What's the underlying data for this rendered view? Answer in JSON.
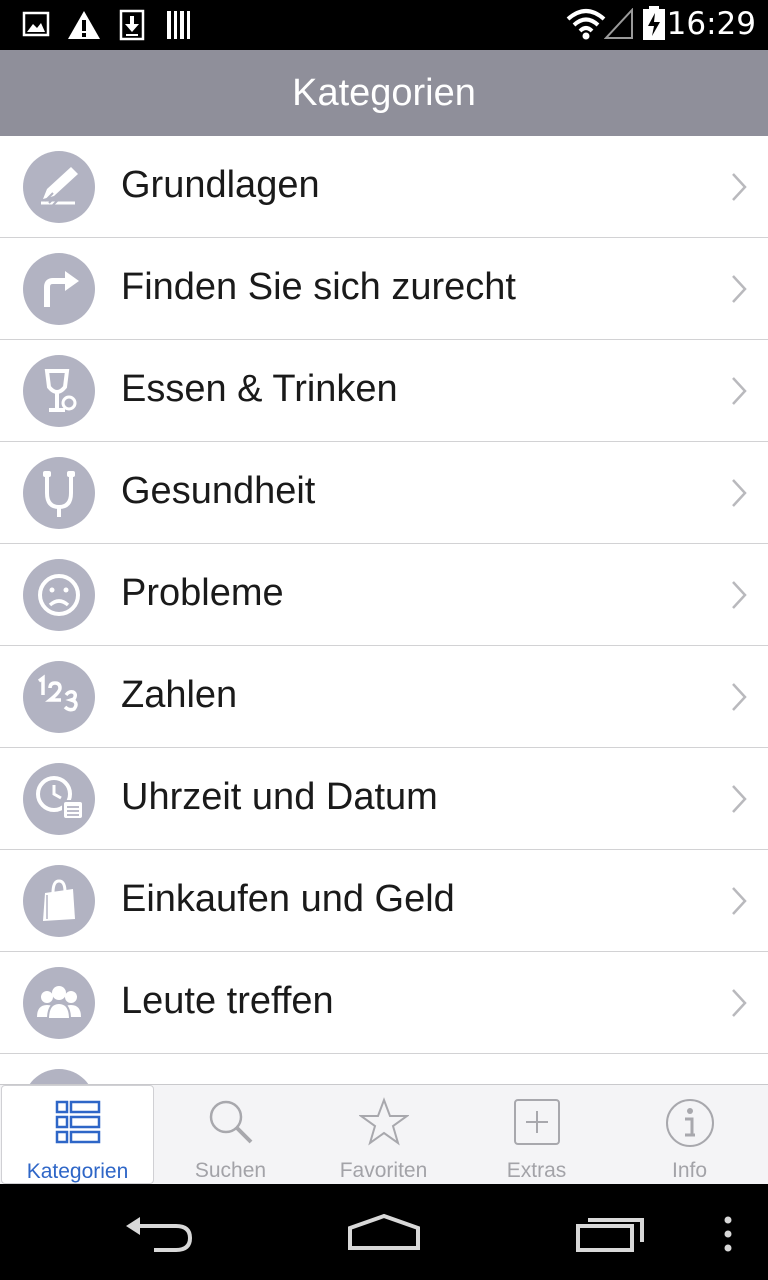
{
  "status_bar": {
    "time": "16:29",
    "left_icons": [
      "image-icon",
      "warning-icon",
      "download-icon",
      "barcode-icon"
    ],
    "right_icons": [
      "wifi-icon",
      "signal-icon",
      "battery-icon"
    ]
  },
  "app_bar": {
    "title": "Kategorien"
  },
  "categories": [
    {
      "label": "Grundlagen",
      "icon": "pencil-icon"
    },
    {
      "label": "Finden Sie sich zurecht",
      "icon": "turn-arrow-icon"
    },
    {
      "label": "Essen & Trinken",
      "icon": "glass-icon"
    },
    {
      "label": "Gesundheit",
      "icon": "stethoscope-icon"
    },
    {
      "label": "Probleme",
      "icon": "sad-face-icon"
    },
    {
      "label": "Zahlen",
      "icon": "numbers-icon"
    },
    {
      "label": "Uhrzeit und Datum",
      "icon": "clock-calendar-icon"
    },
    {
      "label": "Einkaufen und Geld",
      "icon": "shopping-bag-icon"
    },
    {
      "label": "Leute treffen",
      "icon": "people-icon"
    }
  ],
  "tabs": [
    {
      "label": "Kategorien",
      "icon": "list-grid-icon",
      "active": true
    },
    {
      "label": "Suchen",
      "icon": "magnifier-icon",
      "active": false
    },
    {
      "label": "Favoriten",
      "icon": "star-icon",
      "active": false
    },
    {
      "label": "Extras",
      "icon": "plus-box-icon",
      "active": false
    },
    {
      "label": "Info",
      "icon": "info-icon",
      "active": false
    }
  ],
  "nav_bar": {
    "buttons": [
      "back-icon",
      "home-icon",
      "recents-icon",
      "overflow-menu-icon"
    ]
  },
  "colors": {
    "app_bar": "#8f8f9a",
    "icon_circle": "#b2b3c2",
    "active_tab": "#2e66c7",
    "inactive_tab": "#a3a3a8"
  }
}
